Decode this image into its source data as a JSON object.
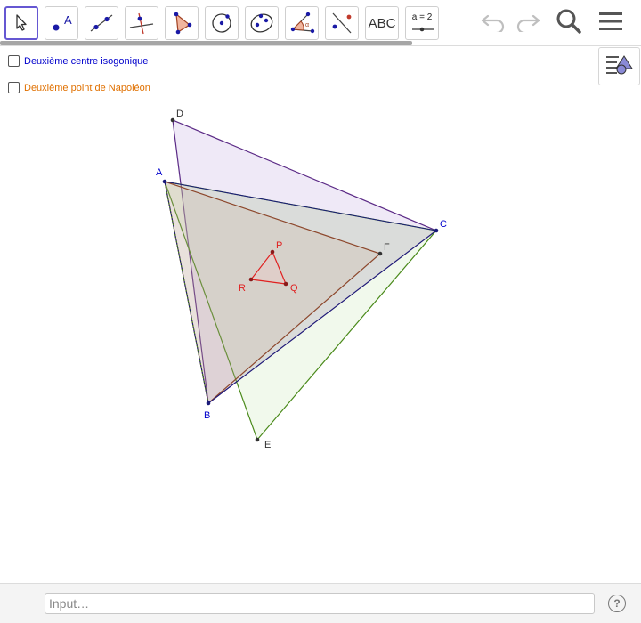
{
  "toolbar": {
    "tools": [
      {
        "name": "move-tool",
        "icon": "arrow-pointer-icon"
      },
      {
        "name": "point-tool",
        "icon": "point-icon",
        "label": "A"
      },
      {
        "name": "line-tool",
        "icon": "line-through-points-icon"
      },
      {
        "name": "perpendicular-tool",
        "icon": "perpendicular-line-icon"
      },
      {
        "name": "polygon-tool",
        "icon": "polygon-icon"
      },
      {
        "name": "circle-tool",
        "icon": "circle-center-point-icon"
      },
      {
        "name": "ellipse-tool",
        "icon": "ellipse-icon"
      },
      {
        "name": "angle-tool",
        "icon": "angle-icon"
      },
      {
        "name": "reflect-tool",
        "icon": "reflect-line-icon"
      },
      {
        "name": "text-tool",
        "label": "ABC"
      },
      {
        "name": "slider-tool",
        "label": "a = 2"
      }
    ],
    "undo_icon": "undo-icon",
    "redo_icon": "redo-icon",
    "search_icon": "search-icon",
    "menu_icon": "hamburger-menu-icon"
  },
  "stylebar_icon": "stylebar-toggle-icon",
  "checkboxes": [
    {
      "label": "Deuxième centre  isogonique",
      "checked": false,
      "color": "#0000cc"
    },
    {
      "label": "Deuxième point de Napoléon",
      "checked": false,
      "color": "#e07000"
    }
  ],
  "points": {
    "A": "A",
    "B": "B",
    "C": "C",
    "D": "D",
    "E": "E",
    "F": "F",
    "P": "P",
    "Q": "Q",
    "R": "R"
  },
  "colors": {
    "accent": "#6557d2",
    "purple_triangle": "#5b2a86",
    "green_triangle": "#4a8a1a",
    "brown_triangle": "#8b3a1a",
    "navy_triangle": "#1a1a7a",
    "red_triangle": "#e02020",
    "label_blue": "#0000cc",
    "label_red": "#e02020"
  },
  "input": {
    "placeholder": "Input…"
  },
  "help_label": "?"
}
